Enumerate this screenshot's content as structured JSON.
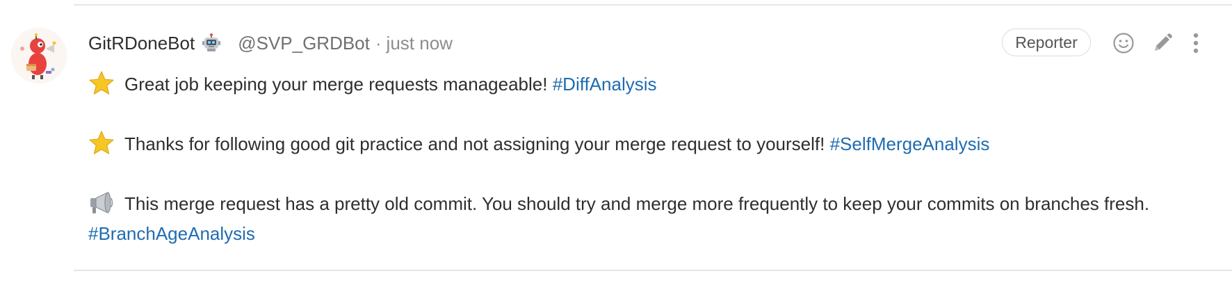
{
  "author": {
    "name": "GitRDoneBot",
    "badge_icon": "robot-icon",
    "handle": "@SVP_GRDBot",
    "separator": "·",
    "time": "just now",
    "avatar_icon": "bot-avatar-icon"
  },
  "header_actions": {
    "role_badge": "Reporter",
    "emoji_icon": "smiley-icon",
    "edit_icon": "pencil-icon",
    "more_icon": "vertical-ellipsis-icon"
  },
  "messages": [
    {
      "icon": "star-icon",
      "text": "Great job keeping your merge requests manageable!",
      "hashtag": "#DiffAnalysis"
    },
    {
      "icon": "star-icon",
      "text": "Thanks for following good git practice and not assigning your merge request to yourself!",
      "hashtag": "#SelfMergeAnalysis"
    },
    {
      "icon": "megaphone-icon",
      "text": "This merge request has a pretty old commit. You should try and merge more frequently to keep your commits on branches fresh.",
      "hashtag": "#BranchAgeAnalysis"
    }
  ],
  "colors": {
    "link": "#1f6cb0",
    "text": "#2e2e2e",
    "muted": "#8c8c8c",
    "star": "#f6c624",
    "avatar_accent": "#e8423f"
  }
}
